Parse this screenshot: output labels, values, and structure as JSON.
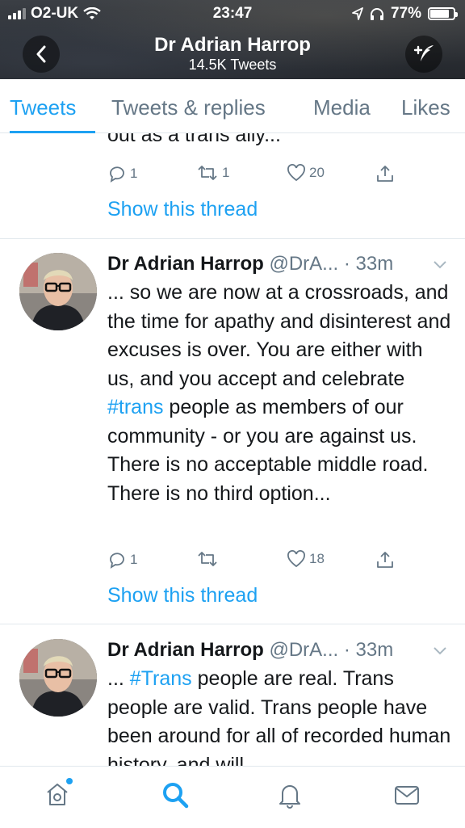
{
  "status_bar": {
    "carrier": "O2-UK",
    "time": "23:47",
    "battery": "77%",
    "battery_level": 0.77
  },
  "header": {
    "name": "Dr Adrian Harrop",
    "tweet_count": "14.5K Tweets"
  },
  "tabs": [
    {
      "label": "Tweets",
      "active": true
    },
    {
      "label": "Tweets & replies"
    },
    {
      "label": "Media"
    },
    {
      "label": "Likes"
    }
  ],
  "tweets": [
    {
      "partial_text": "out as a trans ally...",
      "replies": "1",
      "retweets": "1",
      "likes": "20",
      "show_thread": "Show this thread"
    },
    {
      "name": "Dr Adrian Harrop",
      "handle": "@DrA...",
      "time": "· 33m",
      "text_pre": "... so we are now at a crossroads, and the time for apathy and disinterest and excuses is over. You are either with us, and you accept and celebrate ",
      "hashtag": "#trans",
      "text_post": " people as members of our community - or you are against us. There is no acceptable middle road. There is no third option...",
      "replies": "1",
      "retweets": "",
      "likes": "18",
      "show_thread": "Show this thread"
    },
    {
      "name": "Dr Adrian Harrop",
      "handle": "@DrA...",
      "time": "· 33m",
      "text_pre": "... ",
      "hashtag": "#Trans",
      "text_post": " people are real. Trans people are valid. Trans people have been around for all of recorded human history, and will"
    }
  ],
  "bottom_nav": [
    {
      "icon": "home-icon",
      "active": false,
      "badge": true
    },
    {
      "icon": "search-icon",
      "active": true
    },
    {
      "icon": "notifications-bell-icon",
      "active": false
    },
    {
      "icon": "messages-envelope-icon",
      "active": false
    }
  ],
  "colors": {
    "accent": "#1da1f2",
    "secondary_text": "#657786",
    "primary_text": "#14171a"
  }
}
